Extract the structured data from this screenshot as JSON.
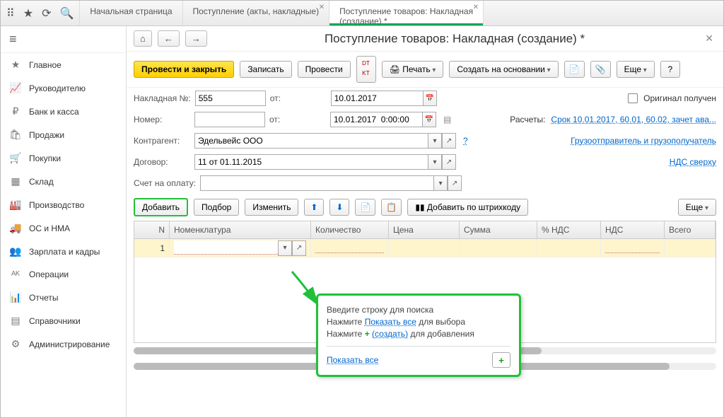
{
  "tabs": {
    "t0": "Начальная страница",
    "t1": "Поступление (акты, накладные)",
    "t2a": "Поступление товаров: Накладная",
    "t2b": "(создание) *"
  },
  "sidebar": {
    "items": [
      {
        "label": "Главное"
      },
      {
        "label": "Руководителю"
      },
      {
        "label": "Банк и касса"
      },
      {
        "label": "Продажи"
      },
      {
        "label": "Покупки"
      },
      {
        "label": "Склад"
      },
      {
        "label": "Производство"
      },
      {
        "label": "ОС и НМА"
      },
      {
        "label": "Зарплата и кадры"
      },
      {
        "label": "Операции"
      },
      {
        "label": "Отчеты"
      },
      {
        "label": "Справочники"
      },
      {
        "label": "Администрирование"
      }
    ]
  },
  "page": {
    "title": "Поступление товаров: Накладная (создание) *"
  },
  "toolbar": {
    "post_close": "Провести и закрыть",
    "write": "Записать",
    "post": "Провести",
    "print": "Печать",
    "create_based": "Создать на основании",
    "more": "Еще"
  },
  "form": {
    "invoice_no_label": "Накладная №:",
    "invoice_no": "555",
    "from": "от:",
    "date": "10.01.2017",
    "number_label": "Номер:",
    "datetime": "10.01.2017  0:00:00",
    "counterparty_label": "Контрагент:",
    "counterparty": "Эдельвейс ООО",
    "contract_label": "Договор:",
    "contract": "11 от 01.11.2015",
    "payment_account_label": "Счет на оплату:",
    "original_received": "Оригинал получен",
    "calc_label": "Расчеты:",
    "calc_link": "Срок 10.01.2017, 60.01, 60.02, зачет ава...",
    "shipper_link": "Грузоотправитель и грузополучатель",
    "vat_link": "НДС сверху"
  },
  "table_toolbar": {
    "add": "Добавить",
    "select": "Подбор",
    "change": "Изменить",
    "barcode": "Добавить по штрихкоду",
    "more": "Еще"
  },
  "table": {
    "headers": {
      "n": "N",
      "nom": "Номенклатура",
      "qty": "Количество",
      "price": "Цена",
      "sum": "Сумма",
      "vat": "% НДС",
      "nds": "НДС",
      "total": "Всего"
    },
    "row_n": "1"
  },
  "hint": {
    "line1": "Введите строку для поиска",
    "line2a": "Нажмите ",
    "line2b": "Показать все",
    "line2c": " для выбора",
    "line3a": "Нажмите ",
    "line3b": "(создать)",
    "line3c": " для добавления",
    "show_all": "Показать все"
  }
}
